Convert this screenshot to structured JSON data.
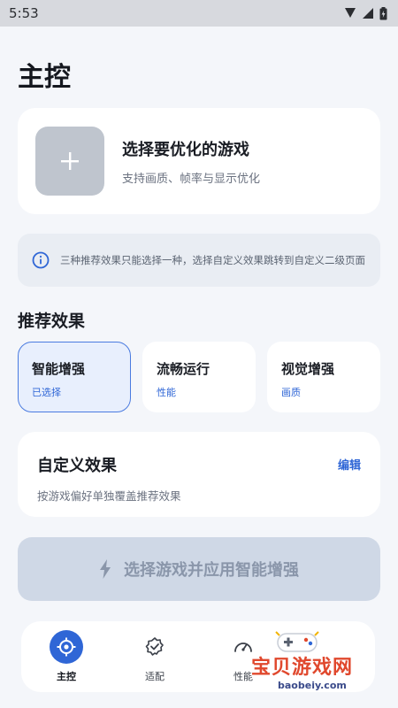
{
  "status_bar": {
    "time": "5:53"
  },
  "page": {
    "title": "主控"
  },
  "select_game": {
    "title": "选择要优化的游戏",
    "subtitle": "支持画质、帧率与显示优化"
  },
  "notice": {
    "text": "三种推荐效果只能选择一种，选择自定义效果跳转到自定义二级页面"
  },
  "recommended": {
    "title": "推荐效果",
    "items": [
      {
        "name": "智能增强",
        "sub": "已选择",
        "selected": true
      },
      {
        "name": "流畅运行",
        "sub": "性能",
        "selected": false
      },
      {
        "name": "视觉增强",
        "sub": "画质",
        "selected": false
      }
    ]
  },
  "custom": {
    "title": "自定义效果",
    "subtitle": "按游戏偏好单独覆盖推荐效果",
    "edit_label": "编辑"
  },
  "apply_button": {
    "label": "选择游戏并应用智能增强"
  },
  "bottom_nav": {
    "items": [
      {
        "label": "主控",
        "icon": "crosshair-icon",
        "active": true
      },
      {
        "label": "适配",
        "icon": "shield-check-icon",
        "active": false
      },
      {
        "label": "性能",
        "icon": "speedometer-icon",
        "active": false
      }
    ]
  },
  "watermark": {
    "text": "宝贝游戏网",
    "url": "baobeiy.com"
  },
  "colors": {
    "accent": "#2f66d6",
    "background": "#f4f6fa",
    "card": "#ffffff",
    "disabled_button": "#cfd8e6"
  }
}
